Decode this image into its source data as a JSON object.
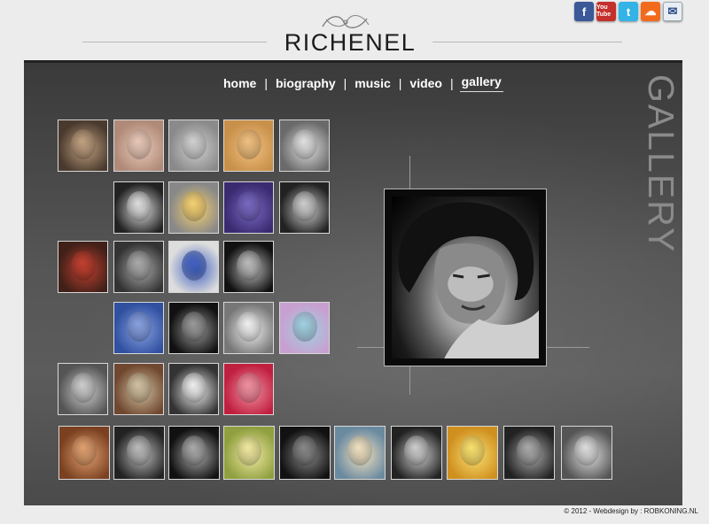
{
  "header": {
    "title": "RICHENEL",
    "social": [
      {
        "name": "facebook-icon",
        "glyph": "f"
      },
      {
        "name": "youtube-icon",
        "glyph": "You Tube"
      },
      {
        "name": "twitter-icon",
        "glyph": "t"
      },
      {
        "name": "soundcloud-icon",
        "glyph": "☁"
      },
      {
        "name": "mail-icon",
        "glyph": "✉"
      }
    ]
  },
  "nav": {
    "items": [
      "home",
      "biography",
      "music",
      "video",
      "gallery"
    ],
    "active": "gallery"
  },
  "section_label": "GALLERY",
  "footer": "© 2012 - Webdesign by : ROBKONING.NL",
  "colors": {
    "panel": "#4a4a4a",
    "thumb_border": "#d8d8d8"
  }
}
